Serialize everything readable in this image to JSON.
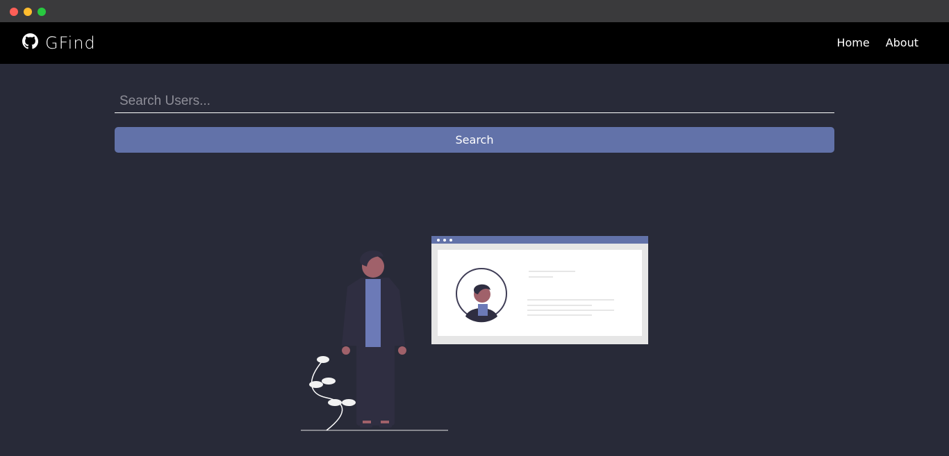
{
  "window": {
    "controls": [
      "close",
      "minimize",
      "maximize"
    ]
  },
  "navbar": {
    "brand_icon": "github-icon",
    "brand_text": "GFind",
    "links": [
      {
        "label": "Home"
      },
      {
        "label": "About"
      }
    ]
  },
  "search": {
    "placeholder": "Search Users...",
    "value": "",
    "button_label": "Search"
  },
  "illustration": {
    "description_icon": "profile-search-illustration"
  },
  "colors": {
    "background": "#282a38",
    "navbar": "#000000",
    "accent": "#6272a9",
    "text": "#ffffff"
  }
}
